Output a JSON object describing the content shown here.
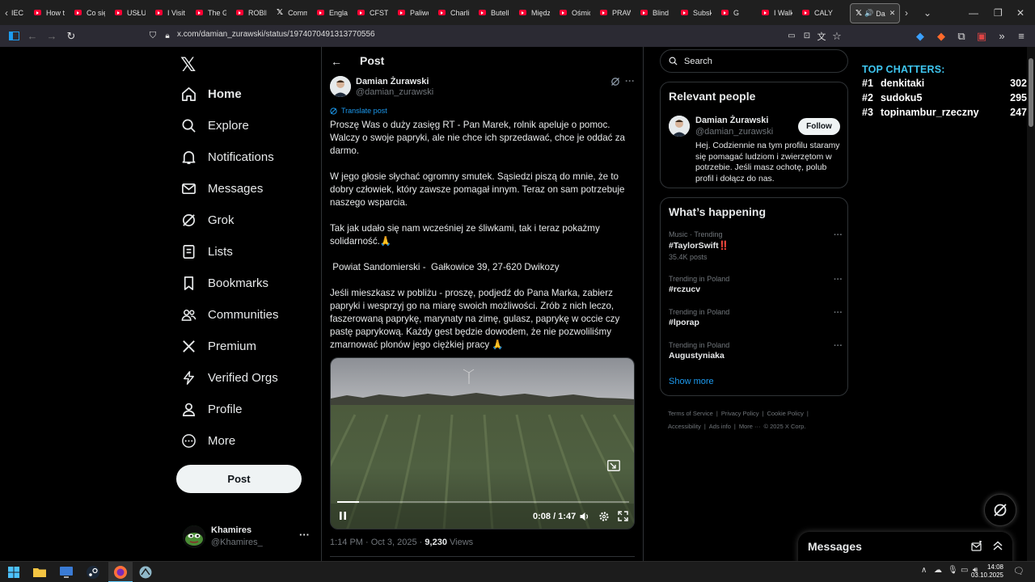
{
  "browser": {
    "tabs": [
      {
        "label": "IEC",
        "kind": "none"
      },
      {
        "label": "How t",
        "kind": "yt"
      },
      {
        "label": "Co się",
        "kind": "yt"
      },
      {
        "label": "USŁUC",
        "kind": "yt"
      },
      {
        "label": "I Visit",
        "kind": "yt"
      },
      {
        "label": "The G",
        "kind": "yt"
      },
      {
        "label": "ROBIN",
        "kind": "yt"
      },
      {
        "label": "Comm",
        "kind": "x"
      },
      {
        "label": "Engla",
        "kind": "yt"
      },
      {
        "label": "CFSTV",
        "kind": "yt"
      },
      {
        "label": "Paliwo",
        "kind": "yt"
      },
      {
        "label": "Charli",
        "kind": "yt"
      },
      {
        "label": "Butell",
        "kind": "yt"
      },
      {
        "label": "Międz",
        "kind": "yt"
      },
      {
        "label": "Ośmic",
        "kind": "yt"
      },
      {
        "label": "PRAW",
        "kind": "yt"
      },
      {
        "label": "Blind",
        "kind": "yt"
      },
      {
        "label": "Subsk",
        "kind": "yt"
      },
      {
        "label": "G",
        "kind": "yt"
      },
      {
        "label": "I Walk",
        "kind": "yt"
      },
      {
        "label": "CALY",
        "kind": "yt"
      }
    ],
    "active_tab": {
      "label": "Da",
      "icon": "x-logo-icon"
    },
    "url": "x.com/damian_zurawski/status/1974070491313770556"
  },
  "nav": {
    "home": "Home",
    "explore": "Explore",
    "notifications": "Notifications",
    "messages": "Messages",
    "grok": "Grok",
    "lists": "Lists",
    "bookmarks": "Bookmarks",
    "communities": "Communities",
    "premium": "Premium",
    "verified_orgs": "Verified Orgs",
    "profile": "Profile",
    "more": "More",
    "post_button": "Post"
  },
  "account": {
    "name": "Khamires",
    "handle": "@Khamires_"
  },
  "post": {
    "header": "Post",
    "author_name": "Damian Żurawski",
    "author_handle": "@damian_zurawski",
    "translate": "Translate post",
    "paragraphs": [
      "Proszę Was o duży zasięg RT - Pan Marek, rolnik apeluje o pomoc. Walczy o swoje papryki, ale nie chce ich sprzedawać, chce je oddać za darmo.",
      "W jego głosie słychać ogromny smutek. Sąsiedzi piszą do mnie, że to dobry człowiek, który zawsze pomagał innym. Teraz on sam potrzebuje naszego wsparcia.",
      "Tak jak udało się nam wcześniej ze śliwkami, tak i teraz pokażmy solidarność.🙏",
      " Powiat Sandomierski -  Gałkowice 39, 27-620 Dwikozy",
      "Jeśli mieszkasz w pobliżu - proszę, podjedź do Pana Marka, zabierz papryki i wesprzyj go na miarę swoich możliwości. Zrób z nich leczo, faszerowaną paprykę, marynaty na zimę, gulasz, paprykę w occie czy pastę paprykową. Każdy gest będzie dowodem, że nie pozwoliliśmy zmarnować plonów jego ciężkiej pracy 🙏"
    ],
    "video": {
      "time": "0:08 / 1:47",
      "progress": 0.076
    },
    "timestamp": "1:14 PM · Oct 3, 2025",
    "separator": " · ",
    "views_count": "9,230",
    "views_label": " Views"
  },
  "sidebar": {
    "search_placeholder": "Search",
    "relevant_title": "Relevant people",
    "person": {
      "name": "Damian Żurawski",
      "handle": "@damian_zurawski",
      "follow": "Follow",
      "bio": "Hej. Codziennie na tym profilu staramy się pomagać ludziom i zwierzętom w potrzebie. Jeśli masz ochotę, polub profil i dołącz do nas."
    },
    "happening_title": "What’s happening",
    "trends": [
      {
        "category": "Music · Trending",
        "name": "#TaylorSwift‼️",
        "count": "35.4K posts"
      },
      {
        "category": "Trending in Poland",
        "name": "#rczucv",
        "count": ""
      },
      {
        "category": "Trending in Poland",
        "name": "#lporap",
        "count": ""
      },
      {
        "category": "Trending in Poland",
        "name": "Augustyniaka",
        "count": ""
      }
    ],
    "show_more": "Show more",
    "footer": [
      "Terms of Service",
      "|",
      "Privacy Policy",
      "|",
      "Cookie Policy",
      "|",
      "Accessibility",
      "|",
      "Ads info",
      "|",
      "More ···",
      "© 2025 X Corp."
    ]
  },
  "chatters": {
    "title": "TOP CHATTERS:",
    "rows": [
      {
        "rank": "#1",
        "user": "denkitaki",
        "score": "302"
      },
      {
        "rank": "#2",
        "user": "sudoku5",
        "score": "295"
      },
      {
        "rank": "#3",
        "user": "topinambur_rzeczny",
        "score": "247"
      }
    ]
  },
  "messages_drawer": {
    "title": "Messages"
  },
  "taskbar": {
    "time": "14:08",
    "date": "03.10.2025"
  },
  "colors": {
    "accent": "#1d9bf0",
    "chatters_title": "#3ec6f0",
    "youtube": "#ff0033"
  }
}
